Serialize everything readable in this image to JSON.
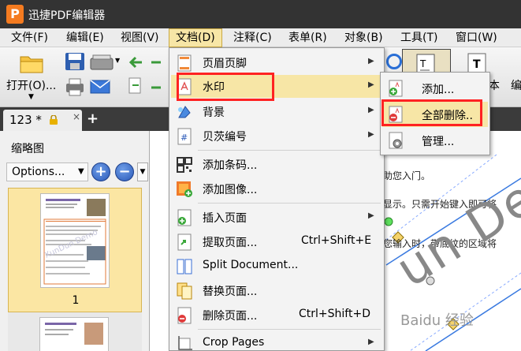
{
  "app": {
    "logo_letter": "P",
    "title": "迅捷PDF编辑器"
  },
  "menubar": {
    "items": [
      {
        "label": "文件(F)"
      },
      {
        "label": "编辑(E)"
      },
      {
        "label": "视图(V)"
      },
      {
        "label": "文档(D)"
      },
      {
        "label": "注释(C)"
      },
      {
        "label": "表单(R)"
      },
      {
        "label": "对象(B)"
      },
      {
        "label": "工具(T)"
      },
      {
        "label": "窗口(W)"
      }
    ]
  },
  "toolbar": {
    "open_label": "打开(O)...",
    "right_label_1": "本",
    "right_label_2": "编"
  },
  "tabs": {
    "doc_label": "123 *",
    "close": "×",
    "new_tab": "+"
  },
  "thumbnails": {
    "title": "缩略图",
    "options_label": "Options...",
    "zoom_in": "+",
    "zoom_out": "−",
    "page1_number": "1",
    "watermark_text": "XunDun Demo"
  },
  "document_text": {
    "line1": "助您入门。",
    "line2": "显示。只需开始键入即可将",
    "line3": "您输入时，带底纹的区域将",
    "watermark": "un De",
    "brand": "Baidu 经验"
  },
  "dropdown": {
    "items": [
      {
        "label": "页眉页脚",
        "submenu": true
      },
      {
        "label": "水印",
        "submenu": true
      },
      {
        "label": "背景",
        "submenu": true
      },
      {
        "label": "贝茨编号",
        "submenu": true
      },
      {
        "label": "添加条码..."
      },
      {
        "label": "添加图像..."
      },
      {
        "label": "插入页面",
        "submenu": true
      },
      {
        "label": "提取页面...",
        "shortcut": "Ctrl+Shift+E"
      },
      {
        "label": "Split Document..."
      },
      {
        "label": "替换页面..."
      },
      {
        "label": "删除页面...",
        "shortcut": "Ctrl+Shift+D"
      },
      {
        "label": "Crop Pages",
        "submenu": true
      }
    ]
  },
  "submenu": {
    "items": [
      {
        "label": "添加..."
      },
      {
        "label": "全部删除.."
      },
      {
        "label": "管理..."
      }
    ]
  },
  "colors": {
    "highlight": "#ff2222",
    "menu_active": "#f7e6a6",
    "titlebar": "#333333",
    "accent_orange": "#f47b20"
  }
}
